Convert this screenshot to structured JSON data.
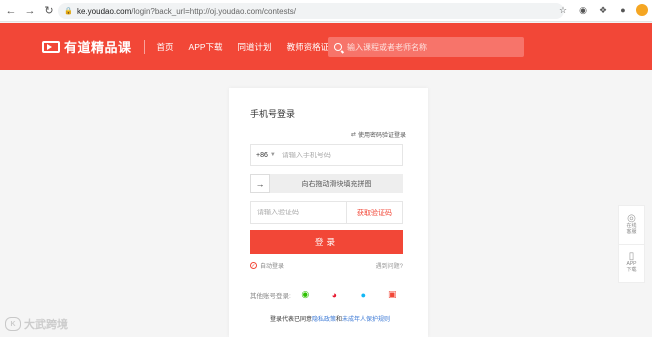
{
  "browser": {
    "url_host": "ke.youdao.com",
    "url_rest": "/login?back_url=http://oj.youdao.com/contests/"
  },
  "header": {
    "logo_text": "有道精品课",
    "nav": [
      {
        "label": "首页"
      },
      {
        "label": "APP下载"
      },
      {
        "label": "同道计划"
      },
      {
        "label": "教师资格证公示"
      }
    ],
    "search_placeholder": "输入课程或者老师名称"
  },
  "login": {
    "title": "手机号登录",
    "switch_label": "使用密码验证登录",
    "country_code": "+86",
    "phone_placeholder": "请输入手机号码",
    "slider_text": "向右拖动滑块填充拼图",
    "code_placeholder": "请输入验证码",
    "get_code_label": "获取验证码",
    "submit_label": "登录",
    "auto_login_label": "自动登录",
    "trouble_label": "遇到问题?",
    "other_login_label": "其他账号登录:",
    "terms_prefix": "登录代表已同意",
    "privacy_link": "隐私政策",
    "terms_and": "和",
    "minor_link": "未成年人保护规则"
  },
  "float_bar": {
    "items": [
      {
        "label_1": "在线",
        "label_2": "客服",
        "icon": "headset-icon"
      },
      {
        "label_1": "APP",
        "label_2": "下载",
        "icon": "phone-icon"
      }
    ]
  },
  "watermark": {
    "text": "大武跨境"
  },
  "colors": {
    "brand": "#f24737",
    "link": "#3d7ad6"
  }
}
